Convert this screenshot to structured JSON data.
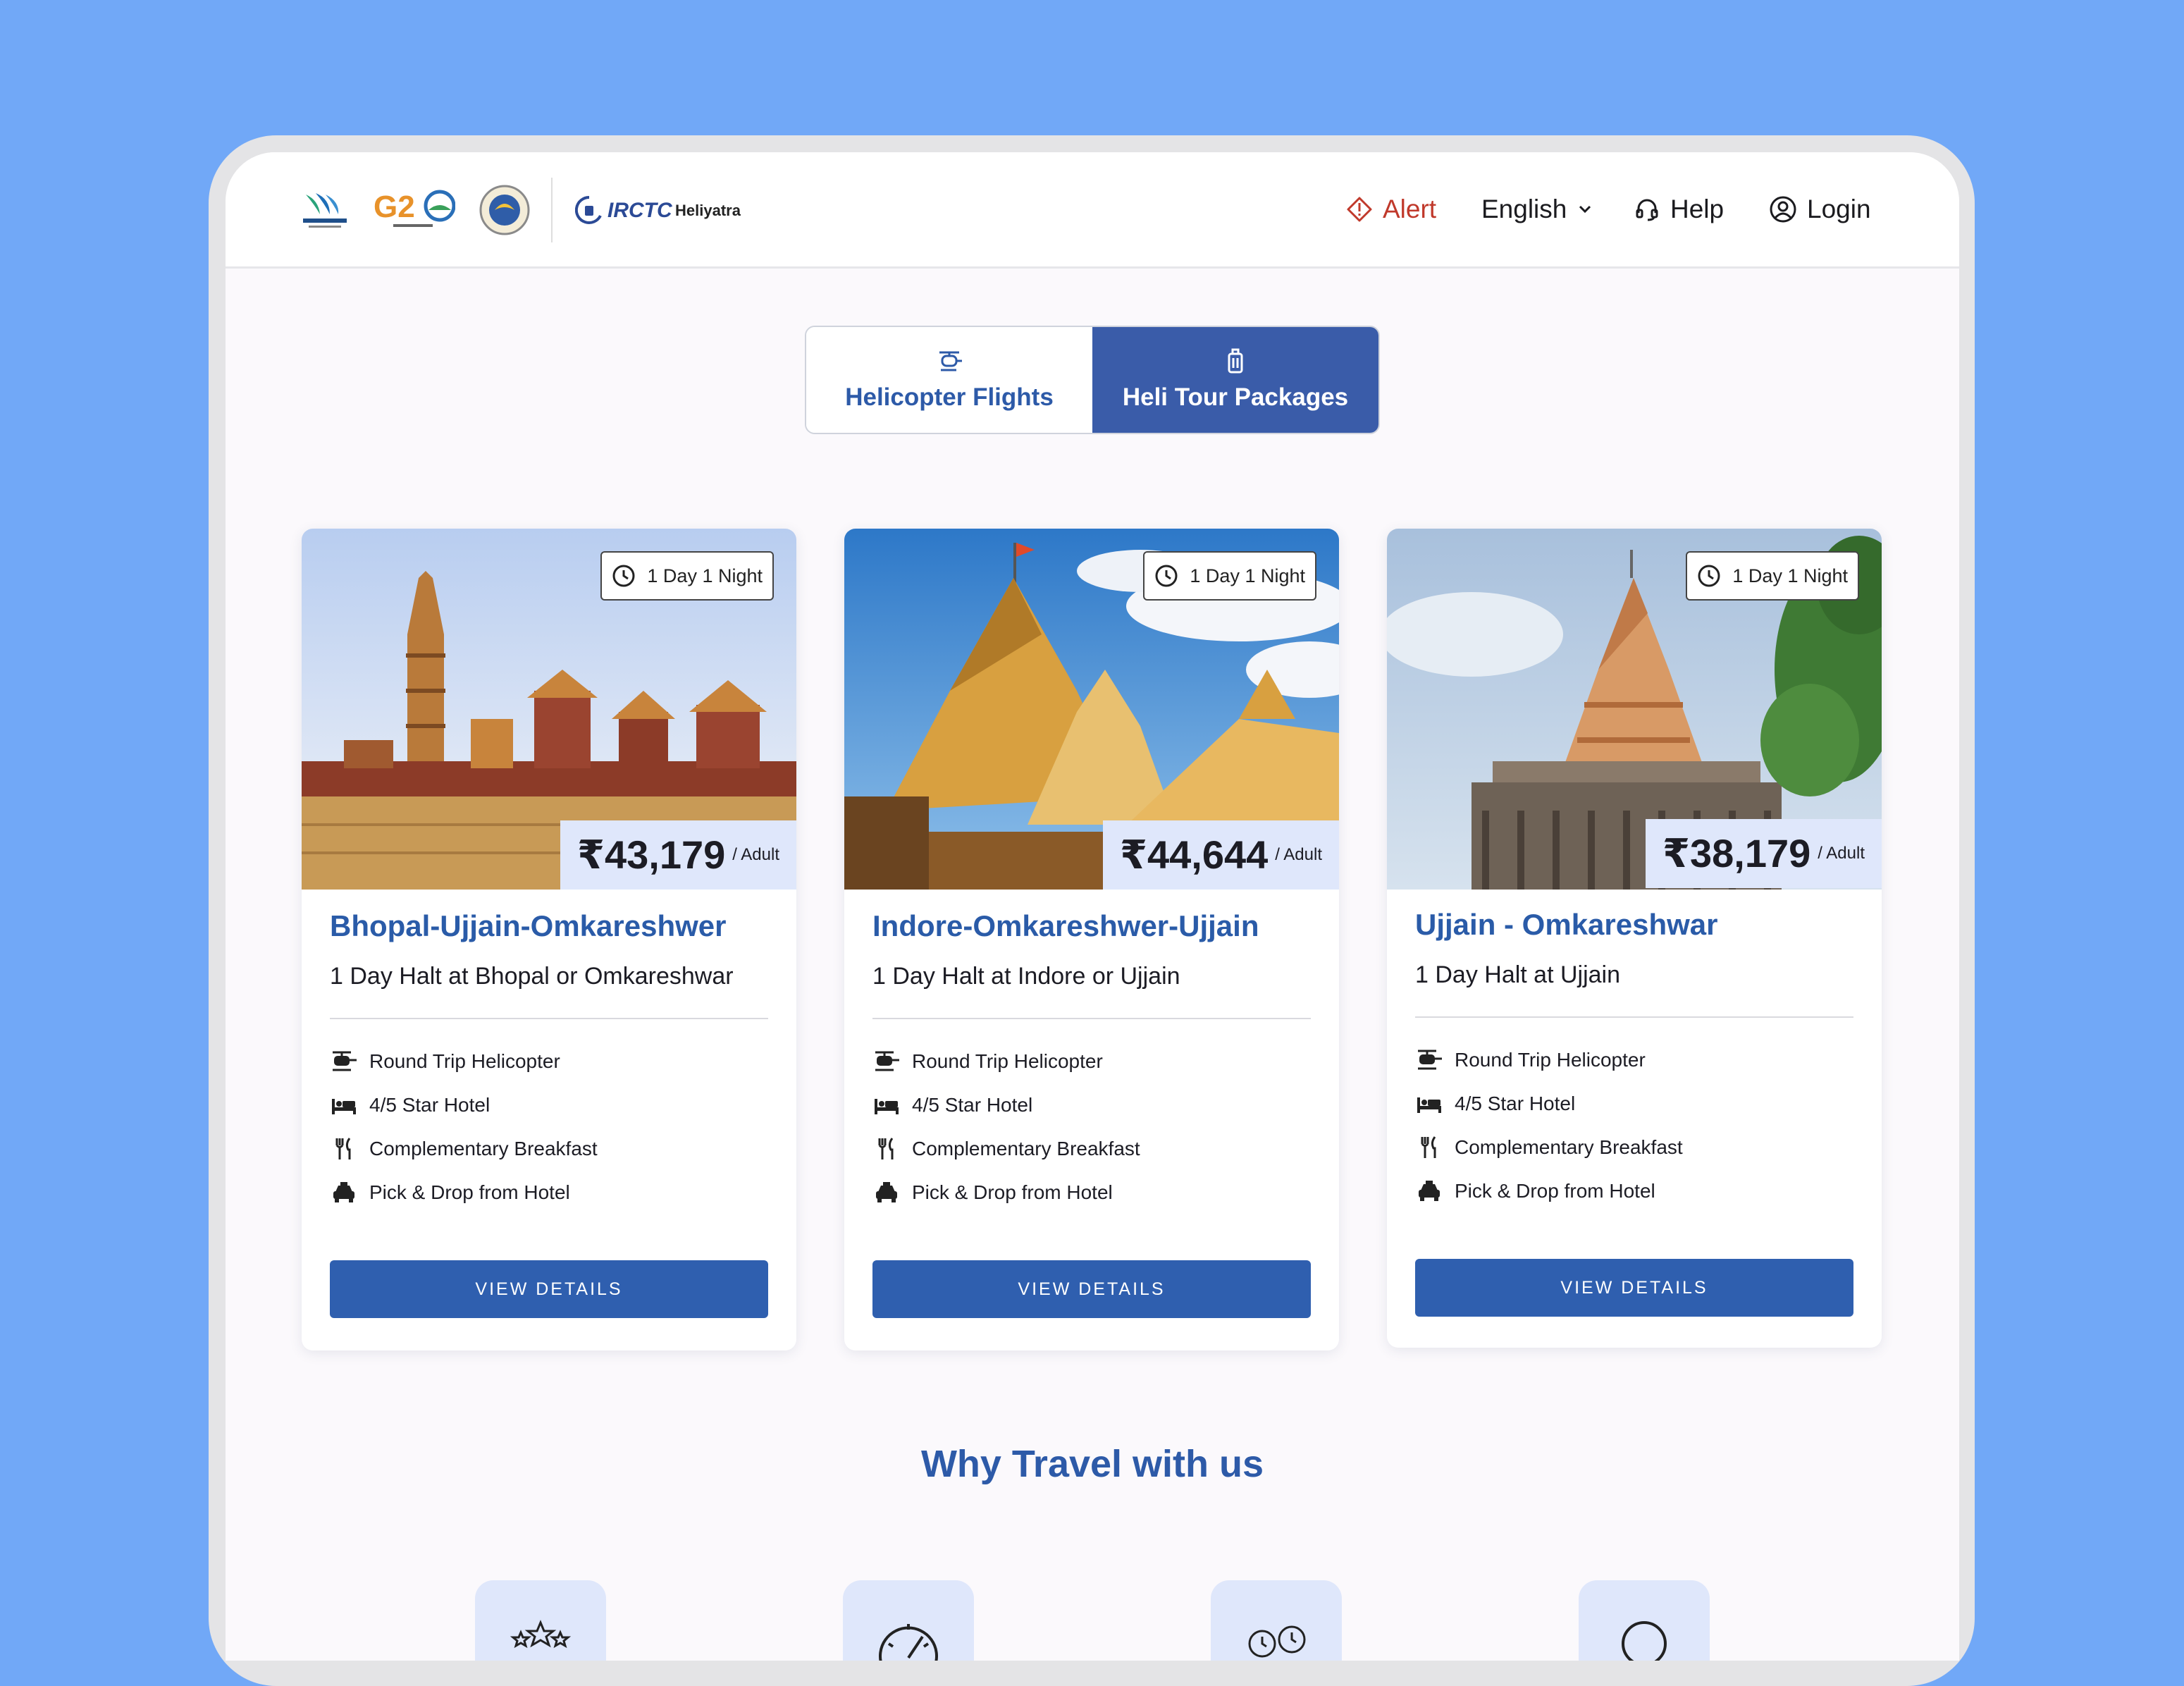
{
  "header": {
    "logos": [
      "uttarakhand-logo",
      "g20-logo",
      "government-seal-logo",
      "irctc-logo"
    ],
    "irctc_text": "IRCTC",
    "heliyatra_text": "Heliyatra",
    "nav": {
      "alert": "Alert",
      "language": "English",
      "help": "Help",
      "login": "Login"
    }
  },
  "tabs": [
    {
      "label": "Helicopter Flights",
      "icon": "helicopter-icon",
      "active": false
    },
    {
      "label": "Heli Tour Packages",
      "icon": "luggage-icon",
      "active": true
    }
  ],
  "packages": [
    {
      "duration": "1 Day 1 Night",
      "price": "₹43,179",
      "price_unit": "/ Adult",
      "title": "Bhopal-Ujjain-Omkareshwer",
      "subtitle": "1 Day Halt at Bhopal or Omkareshwar",
      "features": [
        "Round Trip Helicopter",
        "4/5 Star Hotel",
        "Complementary Breakfast",
        "Pick & Drop from Hotel"
      ],
      "button": "VIEW DETAILS"
    },
    {
      "duration": "1 Day 1 Night",
      "price": "₹44,644",
      "price_unit": "/ Adult",
      "title": "Indore-Omkareshwer-Ujjain",
      "subtitle": "1 Day Halt at Indore or Ujjain",
      "features": [
        "Round Trip Helicopter",
        "4/5 Star Hotel",
        "Complementary Breakfast",
        "Pick & Drop from Hotel"
      ],
      "button": "VIEW DETAILS"
    },
    {
      "duration": "1 Day 1 Night",
      "price": "₹38,179",
      "price_unit": "/ Adult",
      "title": "Ujjain - Omkareshwar",
      "subtitle": "1 Day Halt at Ujjain",
      "features": [
        "Round Trip Helicopter",
        "4/5 Star Hotel",
        "Complementary Breakfast",
        "Pick & Drop from Hotel"
      ],
      "button": "VIEW DETAILS"
    }
  ],
  "why": {
    "heading": "Why Travel with us",
    "tiles": [
      "stars-icon",
      "speedometer-icon",
      "clocks-icon",
      "person-icon"
    ]
  },
  "colors": {
    "background": "#71a8f7",
    "brand_blue": "#2f5faf",
    "title_blue": "#2a5ba8",
    "alert_red": "#c0392b",
    "price_bg": "#dfe7fb"
  }
}
